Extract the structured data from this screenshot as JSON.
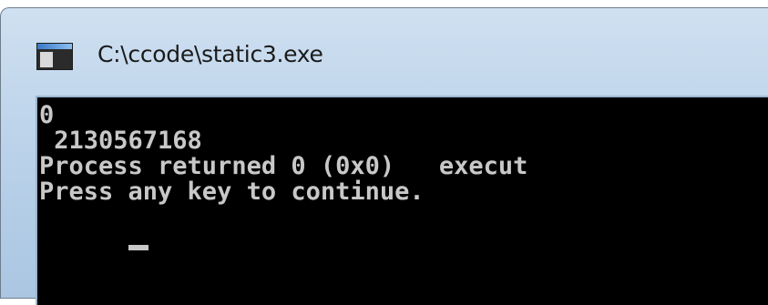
{
  "window": {
    "title": "C:\\ccode\\static3.exe",
    "icon": "console-window-icon"
  },
  "console": {
    "lines": [
      "0",
      " 2130567168",
      "Process returned 0 (0x0)   execut",
      "Press any key to continue.",
      ""
    ]
  }
}
